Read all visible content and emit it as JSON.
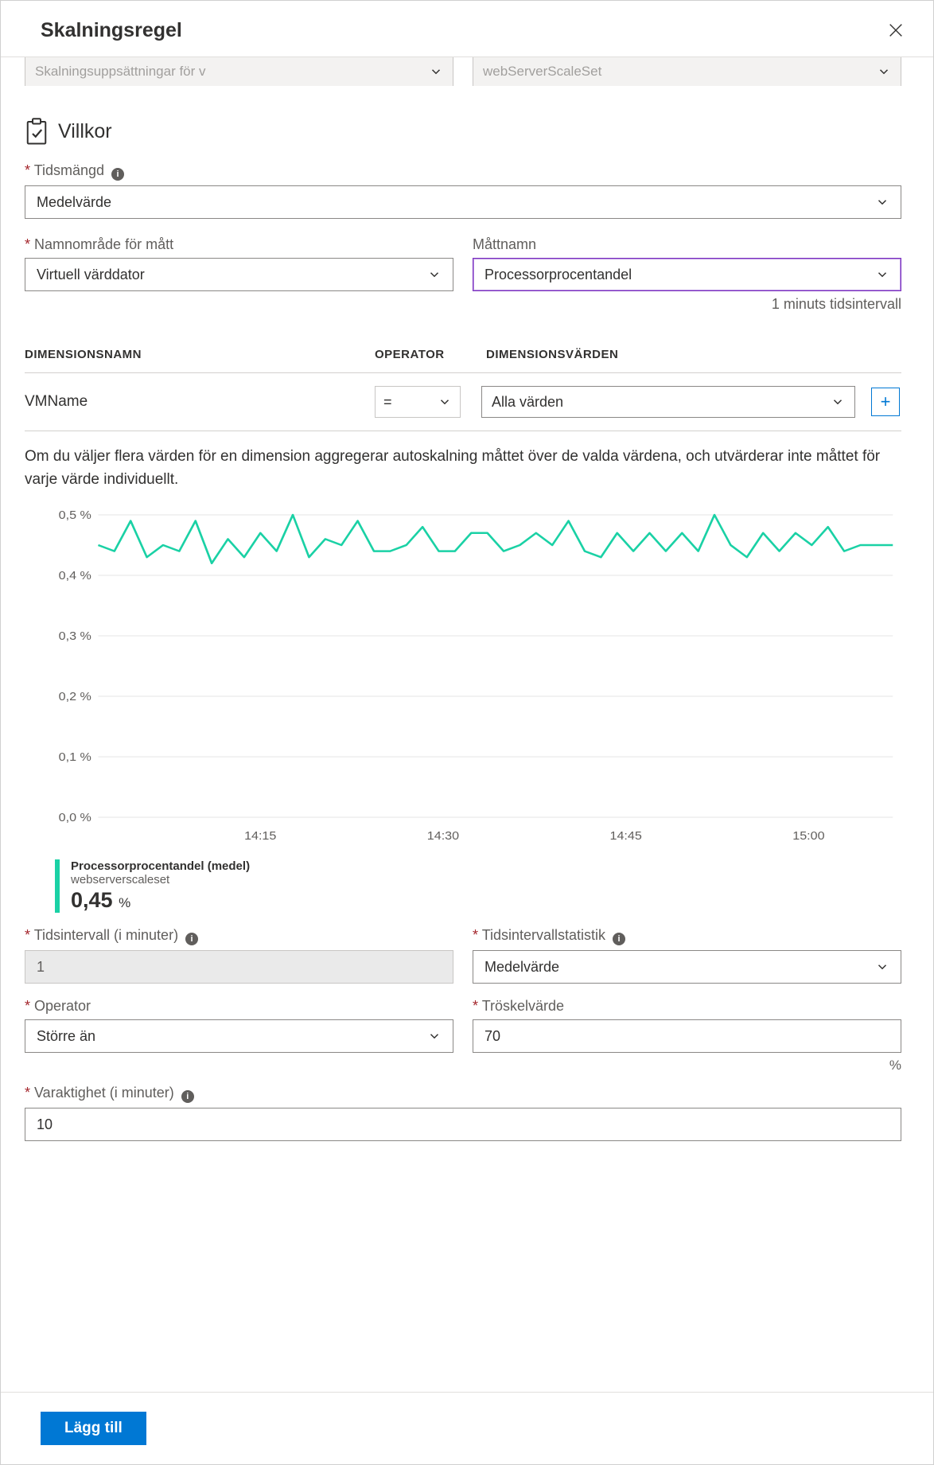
{
  "header": {
    "title": "Skalningsregel"
  },
  "top": {
    "source_label": "Skalningsuppsättningar för v",
    "resource_label": "webServerScaleSet"
  },
  "criteria": {
    "section_title": "Villkor",
    "time_agg_label": "Tidsmängd",
    "time_agg_value": "Medelvärde",
    "namespace_label": "Namnområde för mått",
    "namespace_value": "Virtuell värddator",
    "metric_label": "Måttnamn",
    "metric_value": "Processorprocentandel",
    "interval_hint": "1 minuts tidsintervall"
  },
  "dimensions": {
    "header_name": "Dimensionsnamn",
    "header_operator": "Operator",
    "header_values": "Dimensionsvärden",
    "row_name": "VMName",
    "row_operator": "=",
    "row_value": "Alla värden"
  },
  "description": "Om du väljer flera värden för en dimension aggregerar autoskalning måttet över de valda värdena, och utvärderar inte måttet för varje värde individuellt.",
  "legend": {
    "title": "Processorprocentandel (medel)",
    "subtitle": "webserverscaleset",
    "value": "0,45",
    "unit": "%"
  },
  "form": {
    "duration_label": "Tidsintervall (i minuter)",
    "duration_value": "1",
    "stat_label": "Tidsintervallstatistik",
    "stat_value": "Medelvärde",
    "operator_label": "Operator",
    "operator_value": "Större än",
    "threshold_label": "Tröskelvärde",
    "threshold_value": "70",
    "threshold_unit": "%",
    "varaktighet_label": "Varaktighet (i minuter)",
    "varaktighet_value": "10"
  },
  "footer": {
    "add_label": "Lägg till"
  },
  "chart_data": {
    "type": "line",
    "title": "",
    "xlabel": "",
    "ylabel": "",
    "y_ticks": [
      "0,5 %",
      "0,4 %",
      "0,3 %",
      "0,2 %",
      "0,1 %",
      "0,0 %"
    ],
    "x_ticks": [
      "14:15",
      "14:30",
      "14:45",
      "15:00"
    ],
    "ylim": [
      0.0,
      0.5
    ],
    "series": [
      {
        "name": "Processorprocentandel (medel)",
        "color": "#1ad1a5",
        "values": [
          0.45,
          0.44,
          0.49,
          0.43,
          0.45,
          0.44,
          0.49,
          0.42,
          0.46,
          0.43,
          0.47,
          0.44,
          0.5,
          0.43,
          0.46,
          0.45,
          0.49,
          0.44,
          0.44,
          0.45,
          0.48,
          0.44,
          0.44,
          0.47,
          0.47,
          0.44,
          0.45,
          0.47,
          0.45,
          0.49,
          0.44,
          0.43,
          0.47,
          0.44,
          0.47,
          0.44,
          0.47,
          0.44,
          0.5,
          0.45,
          0.43,
          0.47,
          0.44,
          0.47,
          0.45,
          0.48,
          0.44,
          0.45,
          0.45,
          0.45
        ]
      }
    ]
  }
}
